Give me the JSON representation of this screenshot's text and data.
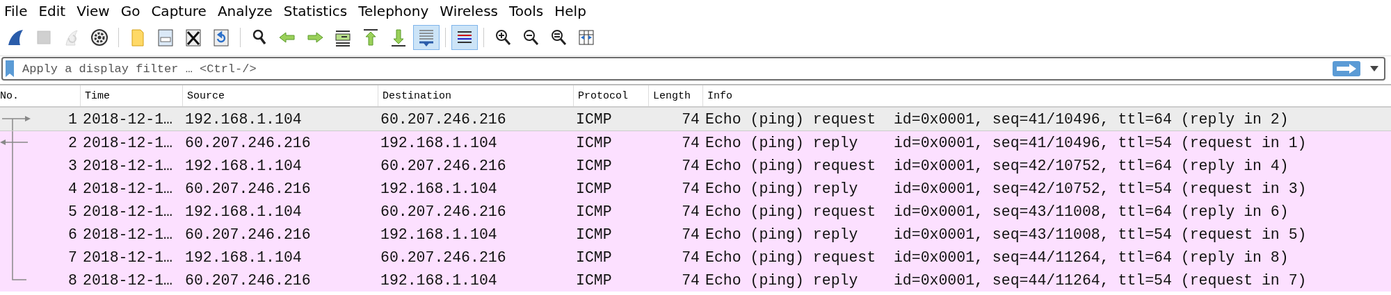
{
  "menu": [
    "File",
    "Edit",
    "View",
    "Go",
    "Capture",
    "Analyze",
    "Statistics",
    "Telephony",
    "Wireless",
    "Tools",
    "Help"
  ],
  "toolbar": [
    {
      "kind": "fin",
      "active": false,
      "disabled": false
    },
    {
      "kind": "stop",
      "active": false,
      "disabled": true
    },
    {
      "kind": "restart",
      "active": false,
      "disabled": true
    },
    {
      "kind": "options",
      "active": false,
      "disabled": false
    },
    {
      "kind": "sep"
    },
    {
      "kind": "open",
      "active": false,
      "disabled": false
    },
    {
      "kind": "file",
      "active": false,
      "disabled": false
    },
    {
      "kind": "close",
      "active": false,
      "disabled": false
    },
    {
      "kind": "reload",
      "active": false,
      "disabled": false
    },
    {
      "kind": "sep"
    },
    {
      "kind": "find",
      "active": false,
      "disabled": false
    },
    {
      "kind": "back",
      "active": false,
      "disabled": false
    },
    {
      "kind": "forward",
      "active": false,
      "disabled": false
    },
    {
      "kind": "goto",
      "active": false,
      "disabled": false
    },
    {
      "kind": "first",
      "active": false,
      "disabled": false
    },
    {
      "kind": "last",
      "active": false,
      "disabled": false
    },
    {
      "kind": "autoscroll",
      "active": true,
      "disabled": false
    },
    {
      "kind": "sep"
    },
    {
      "kind": "colorize",
      "active": true,
      "disabled": false
    },
    {
      "kind": "sep"
    },
    {
      "kind": "zoomin",
      "active": false,
      "disabled": false
    },
    {
      "kind": "zoomout",
      "active": false,
      "disabled": false
    },
    {
      "kind": "zoomnormal",
      "active": false,
      "disabled": false
    },
    {
      "kind": "resize",
      "active": false,
      "disabled": false
    }
  ],
  "filter": {
    "placeholder": "Apply a display filter … <Ctrl-/>"
  },
  "table": {
    "columns": [
      "No.",
      "Time",
      "Source",
      "Destination",
      "Protocol",
      "Length",
      "Info"
    ],
    "rows": [
      {
        "kind": "request",
        "selected": true,
        "cells": [
          "1",
          "2018-12-1…",
          "192.168.1.104",
          "60.207.246.216",
          "ICMP",
          "74",
          "Echo (ping) request  id=0x0001, seq=41/10496, ttl=64 (reply in 2)"
        ]
      },
      {
        "kind": "reply",
        "selected": false,
        "cells": [
          "2",
          "2018-12-1…",
          "60.207.246.216",
          "192.168.1.104",
          "ICMP",
          "74",
          "Echo (ping) reply    id=0x0001, seq=41/10496, ttl=54 (request in 1)"
        ]
      },
      {
        "kind": "line",
        "selected": false,
        "cells": [
          "3",
          "2018-12-1…",
          "192.168.1.104",
          "60.207.246.216",
          "ICMP",
          "74",
          "Echo (ping) request  id=0x0001, seq=42/10752, ttl=64 (reply in 4)"
        ]
      },
      {
        "kind": "line",
        "selected": false,
        "cells": [
          "4",
          "2018-12-1…",
          "60.207.246.216",
          "192.168.1.104",
          "ICMP",
          "74",
          "Echo (ping) reply    id=0x0001, seq=42/10752, ttl=54 (request in 3)"
        ]
      },
      {
        "kind": "line",
        "selected": false,
        "cells": [
          "5",
          "2018-12-1…",
          "192.168.1.104",
          "60.207.246.216",
          "ICMP",
          "74",
          "Echo (ping) request  id=0x0001, seq=43/11008, ttl=64 (reply in 6)"
        ]
      },
      {
        "kind": "line",
        "selected": false,
        "cells": [
          "6",
          "2018-12-1…",
          "60.207.246.216",
          "192.168.1.104",
          "ICMP",
          "74",
          "Echo (ping) reply    id=0x0001, seq=43/11008, ttl=54 (request in 5)"
        ]
      },
      {
        "kind": "line",
        "selected": false,
        "cells": [
          "7",
          "2018-12-1…",
          "192.168.1.104",
          "60.207.246.216",
          "ICMP",
          "74",
          "Echo (ping) request  id=0x0001, seq=44/11264, ttl=64 (reply in 8)"
        ]
      },
      {
        "kind": "end",
        "selected": false,
        "cells": [
          "8",
          "2018-12-1…",
          "60.207.246.216",
          "192.168.1.104",
          "ICMP",
          "74",
          "Echo (ping) reply    id=0x0001, seq=44/11264, ttl=54 (request in 7)"
        ]
      }
    ]
  }
}
